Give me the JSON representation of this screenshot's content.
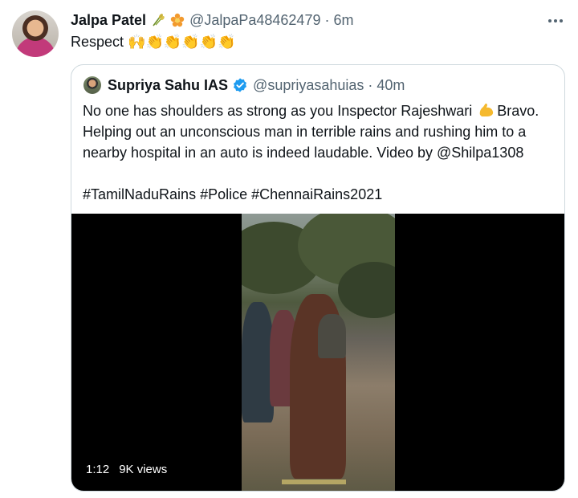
{
  "author": {
    "name": "Jalpa Patel",
    "badges": [
      "sheaf-of-rice-icon",
      "blossom-icon"
    ],
    "handle": "@JalpaPa48462479",
    "separator": "·",
    "time": "6m"
  },
  "tweet_text": "Respect 🙌👏👏👏👏👏",
  "quoted": {
    "name": "Supriya Sahu IAS",
    "verified": true,
    "handle": "@supriyasahuias",
    "separator": "·",
    "time": "40m",
    "text_lines": {
      "l1a": "No one has shoulders as strong as you Inspector Rajeshwari",
      "l1b": "Bravo.",
      "l2": "Helping out an unconscious man in terrible rains and rushing him to a",
      "l3": "nearby hospital in an auto is indeed laudable. Video by @Shilpa1308",
      "l4": "#TamilNaduRains #Police #ChennaiRains2021"
    },
    "video": {
      "duration": "1:12",
      "views": "9K views"
    }
  },
  "colors": {
    "text": "#0f1419",
    "secondary": "#536471",
    "border": "#cfd9de",
    "verified": "#1d9bf0"
  }
}
